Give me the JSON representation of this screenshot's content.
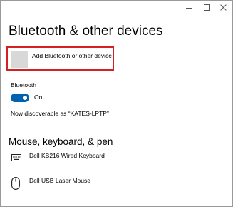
{
  "window": {
    "controls": {
      "minimize_icon": "minimize-icon",
      "maximize_icon": "maximize-icon",
      "close_icon": "close-icon"
    }
  },
  "page": {
    "title": "Bluetooth & other devices"
  },
  "add_device": {
    "label": "Add Bluetooth or other device",
    "icon": "plus-icon",
    "highlight_color": "#d32020"
  },
  "bluetooth": {
    "label": "Bluetooth",
    "toggle_on": true,
    "toggle_state": "On",
    "toggle_color": "#0063b1",
    "discoverable_text": "Now discoverable as “KATES-LPTP”"
  },
  "mouse_keyboard_pen": {
    "heading": "Mouse, keyboard, & pen",
    "devices": [
      {
        "name": "Dell KB216 Wired Keyboard",
        "icon": "keyboard-icon"
      },
      {
        "name": "Dell USB Laser Mouse",
        "icon": "mouse-icon"
      }
    ]
  }
}
